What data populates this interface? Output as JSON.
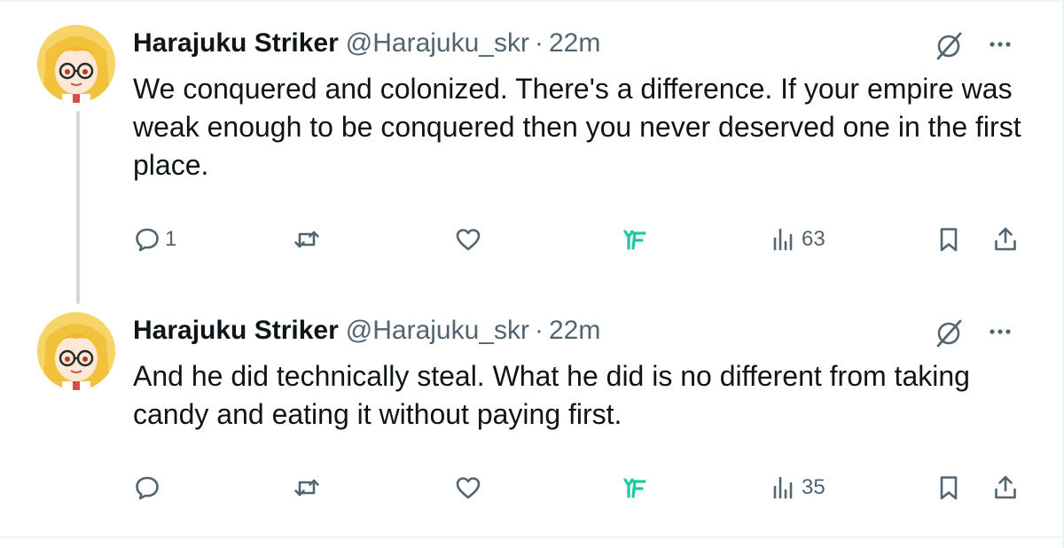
{
  "colors": {
    "text_primary": "#0f1419",
    "text_secondary": "#536471",
    "thread_line": "#cfd9de",
    "accent_grok": "#1dc9a0",
    "divider": "#eff3f4"
  },
  "icons": {
    "reply": "speech-bubble-icon",
    "retweet": "retweet-icon",
    "like": "heart-icon",
    "grok_action": "grok-brand-icon",
    "views": "bar-chart-icon",
    "bookmark": "bookmark-icon",
    "share": "share-icon",
    "grok_header": "grok-slash-icon",
    "more": "ellipsis-icon"
  },
  "tweets": [
    {
      "author_name": "Harajuku Striker",
      "handle": "@Harajuku_skr",
      "separator": "·",
      "time": "22m",
      "text": "We conquered and colonized. There's a difference. If your empire was weak enough to be conquered then you never deserved one in the first place.",
      "reply_count": "1",
      "retweet_count": "",
      "like_count": "",
      "views": "63"
    },
    {
      "author_name": "Harajuku Striker",
      "handle": "@Harajuku_skr",
      "separator": "·",
      "time": "22m",
      "text": "And he did technically steal. What he did is no different from taking candy and eating it without paying first.",
      "reply_count": "",
      "retweet_count": "",
      "like_count": "",
      "views": "35"
    }
  ]
}
